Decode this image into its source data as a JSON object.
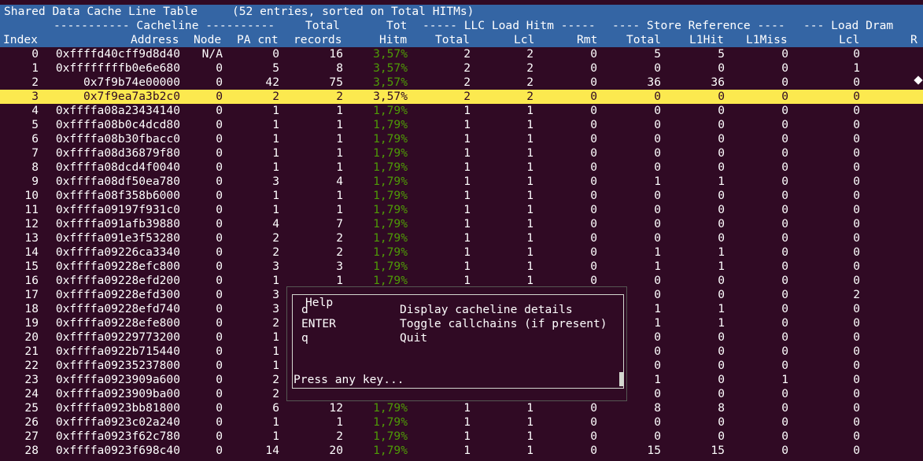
{
  "header": {
    "title": "Shared Data Cache Line Table     (52 entries, sorted on Total HITMs)",
    "group": {
      "cacheline": "----------- Cacheline ----------",
      "total": "Total",
      "tot": "Tot",
      "llc": "----- LLC Load Hitm -----",
      "store": "---- Store Reference ----",
      "dram": "--- Load Dram"
    },
    "columns": {
      "index": "Index",
      "address": "Address",
      "node": "Node",
      "pa_cnt": "PA cnt",
      "records": "records",
      "hitm": "Hitm",
      "llc_total": "Total",
      "llc_lcl": "Lcl",
      "llc_rmt": "Rmt",
      "st_total": "Total",
      "l1hit": "L1Hit",
      "l1miss": "L1Miss",
      "dram_lcl": "Lcl",
      "dram_r": "R"
    }
  },
  "rows": [
    [
      "0",
      "0xffffd40cff9d8d40",
      "N/A",
      "0",
      "16",
      "3,57%",
      "2",
      "2",
      "0",
      "5",
      "5",
      "0",
      "0"
    ],
    [
      "1",
      "0xffffffffb0e6e680",
      "0",
      "5",
      "8",
      "3,57%",
      "2",
      "2",
      "0",
      "0",
      "0",
      "0",
      "1"
    ],
    [
      "2",
      "0x7f9b74e00000",
      "0",
      "42",
      "75",
      "3,57%",
      "2",
      "2",
      "0",
      "36",
      "36",
      "0",
      "0"
    ],
    [
      "3",
      "0x7f9ea7a3b2c0",
      "0",
      "2",
      "2",
      "3,57%",
      "2",
      "2",
      "0",
      "0",
      "0",
      "0",
      "0"
    ],
    [
      "4",
      "0xffffa08a23434140",
      "0",
      "1",
      "1",
      "1,79%",
      "1",
      "1",
      "0",
      "0",
      "0",
      "0",
      "0"
    ],
    [
      "5",
      "0xffffa08b0c4dcd80",
      "0",
      "1",
      "1",
      "1,79%",
      "1",
      "1",
      "0",
      "0",
      "0",
      "0",
      "0"
    ],
    [
      "6",
      "0xffffa08b30fbacc0",
      "0",
      "1",
      "1",
      "1,79%",
      "1",
      "1",
      "0",
      "0",
      "0",
      "0",
      "0"
    ],
    [
      "7",
      "0xffffa08d36879f80",
      "0",
      "1",
      "1",
      "1,79%",
      "1",
      "1",
      "0",
      "0",
      "0",
      "0",
      "0"
    ],
    [
      "8",
      "0xffffa08dcd4f0040",
      "0",
      "1",
      "1",
      "1,79%",
      "1",
      "1",
      "0",
      "0",
      "0",
      "0",
      "0"
    ],
    [
      "9",
      "0xffffa08df50ea780",
      "0",
      "3",
      "4",
      "1,79%",
      "1",
      "1",
      "0",
      "1",
      "1",
      "0",
      "0"
    ],
    [
      "10",
      "0xffffa08f358b6000",
      "0",
      "1",
      "1",
      "1,79%",
      "1",
      "1",
      "0",
      "0",
      "0",
      "0",
      "0"
    ],
    [
      "11",
      "0xffffa09197f931c0",
      "0",
      "1",
      "1",
      "1,79%",
      "1",
      "1",
      "0",
      "0",
      "0",
      "0",
      "0"
    ],
    [
      "12",
      "0xffffa091afb39880",
      "0",
      "4",
      "7",
      "1,79%",
      "1",
      "1",
      "0",
      "0",
      "0",
      "0",
      "0"
    ],
    [
      "13",
      "0xffffa091e3f53280",
      "0",
      "2",
      "2",
      "1,79%",
      "1",
      "1",
      "0",
      "0",
      "0",
      "0",
      "0"
    ],
    [
      "14",
      "0xffffa09226ca3340",
      "0",
      "2",
      "2",
      "1,79%",
      "1",
      "1",
      "0",
      "1",
      "1",
      "0",
      "0"
    ],
    [
      "15",
      "0xffffa09228efc800",
      "0",
      "3",
      "3",
      "1,79%",
      "1",
      "1",
      "0",
      "1",
      "1",
      "0",
      "0"
    ],
    [
      "16",
      "0xffffa09228efd200",
      "0",
      "1",
      "1",
      "1,79%",
      "1",
      "1",
      "0",
      "0",
      "0",
      "0",
      "0"
    ],
    [
      "17",
      "0xffffa09228efd300",
      "0",
      "3",
      "",
      "",
      "",
      "",
      "",
      "0",
      "0",
      "0",
      "2"
    ],
    [
      "18",
      "0xffffa09228efd740",
      "0",
      "3",
      "",
      "",
      "",
      "",
      "",
      "1",
      "1",
      "0",
      "0"
    ],
    [
      "19",
      "0xffffa09228efe800",
      "0",
      "2",
      "",
      "",
      "",
      "",
      "",
      "1",
      "1",
      "0",
      "0"
    ],
    [
      "20",
      "0xffffa09229773200",
      "0",
      "1",
      "",
      "",
      "",
      "",
      "",
      "0",
      "0",
      "0",
      "0"
    ],
    [
      "21",
      "0xffffa0922b715440",
      "0",
      "1",
      "",
      "",
      "",
      "",
      "",
      "0",
      "0",
      "0",
      "0"
    ],
    [
      "22",
      "0xffffa09235237800",
      "0",
      "1",
      "",
      "",
      "",
      "",
      "",
      "0",
      "0",
      "0",
      "0"
    ],
    [
      "23",
      "0xffffa0923909a600",
      "0",
      "2",
      "",
      "",
      "",
      "",
      "",
      "1",
      "0",
      "1",
      "0"
    ],
    [
      "24",
      "0xffffa0923909ba00",
      "0",
      "2",
      "",
      "",
      "",
      "",
      "",
      "0",
      "0",
      "0",
      "0"
    ],
    [
      "25",
      "0xffffa0923bb81800",
      "0",
      "6",
      "12",
      "1,79%",
      "1",
      "1",
      "0",
      "8",
      "8",
      "0",
      "0"
    ],
    [
      "26",
      "0xffffa0923c02a240",
      "0",
      "1",
      "1",
      "1,79%",
      "1",
      "1",
      "0",
      "0",
      "0",
      "0",
      "0"
    ],
    [
      "27",
      "0xffffa0923f62c780",
      "0",
      "1",
      "2",
      "1,79%",
      "1",
      "1",
      "0",
      "0",
      "0",
      "0",
      "0"
    ],
    [
      "28",
      "0xffffa0923f698c40",
      "0",
      "14",
      "20",
      "1,79%",
      "1",
      "1",
      "0",
      "15",
      "15",
      "0",
      "0"
    ]
  ],
  "selected_index": 3,
  "help": {
    "title": "Help",
    "items": [
      {
        "key": "d",
        "desc": "Display cacheline details"
      },
      {
        "key": "ENTER",
        "desc": "Toggle callchains (if present)"
      },
      {
        "key": "q",
        "desc": "Quit"
      }
    ],
    "prompt": "Press any key..."
  },
  "colors": {
    "background": "#300a24",
    "header": "#3465a4",
    "selected_row": "#fce94f",
    "hitm_percent": "#4e9a06"
  }
}
